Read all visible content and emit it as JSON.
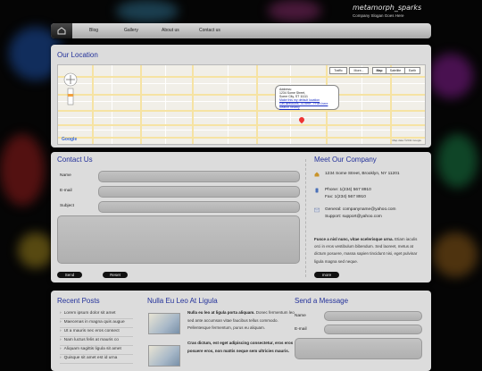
{
  "site": {
    "name": "metamorph_sparks",
    "slogan": "Company Slogan Goes Here"
  },
  "nav": {
    "items": [
      "Blog",
      "Gallery",
      "About us",
      "Contact us"
    ]
  },
  "location": {
    "title": "Our Location",
    "map_types": [
      "Traffic",
      "More...",
      "Map",
      "Satellite",
      "Earth"
    ],
    "bubble": {
      "lines": [
        "Address:",
        "1234 Some Street,",
        "Some City, ST 11111"
      ],
      "link1": "Make this my default location",
      "directions": "Get directions: To here - From here",
      "search": "Search nearby"
    },
    "brand": "Google",
    "copyright": "Map data ©2011 Google"
  },
  "contact": {
    "title": "Contact Us",
    "name_label": "Name",
    "email_label": "E-mail",
    "subject_label": "Subject",
    "send_label": "Send",
    "reset_label": "Reset"
  },
  "company": {
    "title": "Meet Our Company",
    "address": "1234 Some Street, Brooklyn, NY 11201",
    "phone": "Phone: 1(234) 567 8910",
    "fax": "Fax: 1(234) 567 8910",
    "general": "General: companyname@yahoo.com",
    "support": "Support: support@yahoo.com",
    "about_bold": "Fusce a nisl nunc, vitae scelerisque urna.",
    "about_text": "Etiam iaculis orci in eros vestibulum bibendum. Sed laoreet, metus at dictum posuere, massa sapien tincidunt nisi, eget pulvinar ligula magna sed neque.",
    "more_label": "more"
  },
  "recent": {
    "title": "Recent Posts",
    "items": [
      "Lorem ipsum dolor sit amet",
      "Maecenas in magna quis augue",
      "Ut a mauris nec eros consect",
      "Nam luctus felis at mauris co",
      "Aliquam sagittis ligula sit amet",
      "Quisque sit amet est id urna"
    ]
  },
  "news": {
    "title": "Nulla Eu Leo At Ligula",
    "items": [
      {
        "bold": "Nulla eu leo at ligula porta aliquam.",
        "text": "Donec fermentum leo sed ante accumsan vitae faucibus tellus commodo. Pellentesque fermentum, purus eu aliquam."
      },
      {
        "bold": "Cras dictum, est eget adipiscing consectetur, eros eros posuere eros, non mattis neque sem ultricies mauris.",
        "text": ""
      }
    ]
  },
  "message": {
    "title": "Send a Message",
    "name_label": "Name",
    "email_label": "E-mail"
  },
  "colors": {
    "heading": "#23319a",
    "panel": "#dcdcdc",
    "background": "#050505"
  }
}
